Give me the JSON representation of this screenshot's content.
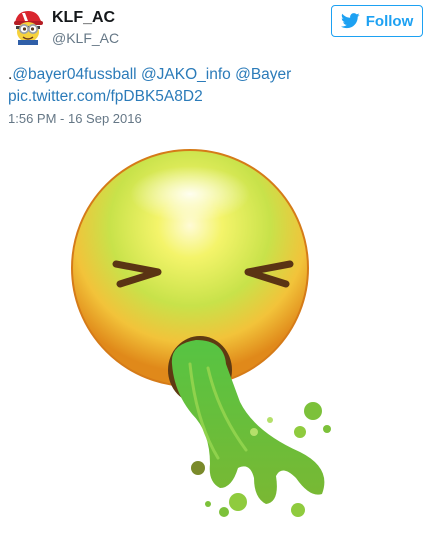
{
  "user": {
    "display_name": "KLF_AC",
    "screen_name": "@KLF_AC",
    "avatar_icon": "minion-avatar-icon"
  },
  "follow_button": {
    "label": "Follow",
    "icon": "twitter-bird-icon",
    "color": "#1da1f2"
  },
  "tweet": {
    "text_prefix": ".",
    "mentions": [
      "@bayer04fussball",
      "@JAKO_info",
      "@Bayer"
    ],
    "link": "pic.twitter.com/fpDBK5A8D2",
    "timestamp": "1:56 PM - 16 Sep 2016",
    "link_color": "#2b7bb9"
  },
  "media": {
    "icon": "vomiting-face-emoji-icon"
  }
}
